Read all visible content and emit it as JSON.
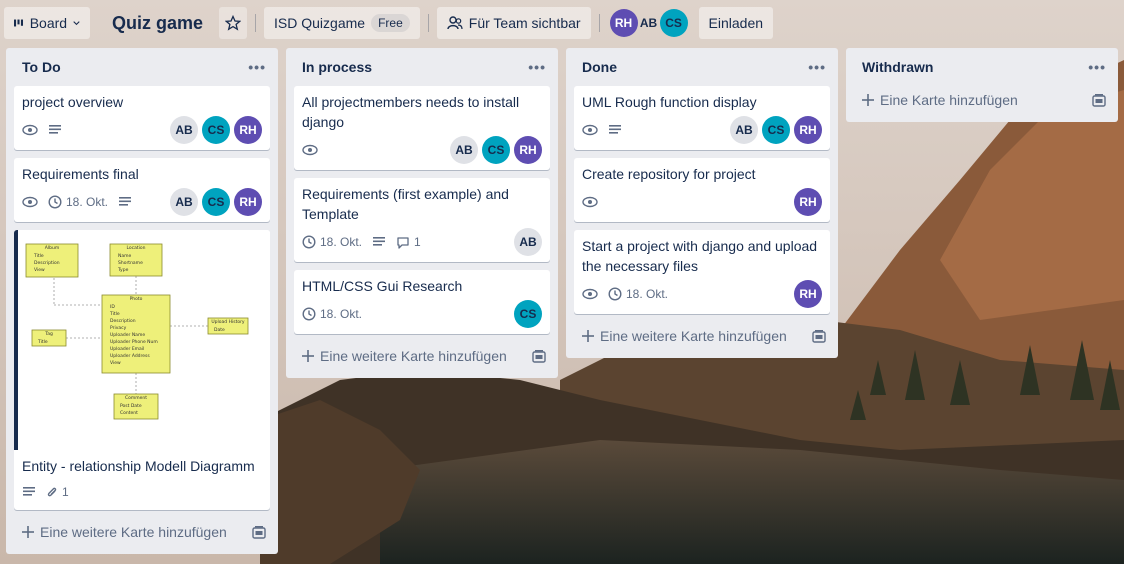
{
  "header": {
    "board_button": "Board",
    "board_title": "Quiz game",
    "workspace": "ISD Quizgame",
    "plan_badge": "Free",
    "visibility": "Für Team sichtbar",
    "invite": "Einladen",
    "members": [
      "RH",
      "AB",
      "CS"
    ]
  },
  "lists": [
    {
      "title": "To Do",
      "cards": [
        {
          "title": "project overview",
          "members": [
            "AB",
            "CS",
            "RH"
          ]
        },
        {
          "title": "Requirements final",
          "date": "18. Okt.",
          "members": [
            "AB",
            "CS",
            "RH"
          ]
        },
        {
          "title": "Entity - relationship Modell Diagramm",
          "attachments": "1",
          "diagram": {
            "entities": [
              {
                "name": "Album",
                "fields": [
                  "Title",
                  "Description",
                  "View"
                ]
              },
              {
                "name": "Location",
                "fields": [
                  "Name",
                  "Shortname",
                  "Type"
                ]
              },
              {
                "name": "Photo",
                "fields": [
                  "ID",
                  "Title",
                  "Description",
                  "Privacy",
                  "Uploader Name",
                  "Uploader Phone Num",
                  "Uploader Email",
                  "Uploader Address",
                  "View"
                ]
              },
              {
                "name": "Tag",
                "fields": [
                  "Title"
                ]
              },
              {
                "name": "Upload History",
                "fields": [
                  "Date"
                ]
              },
              {
                "name": "Comment",
                "fields": [
                  "Post Date",
                  "Content"
                ]
              }
            ]
          }
        }
      ],
      "add_label": "Eine weitere Karte hinzufügen"
    },
    {
      "title": "In process",
      "cards": [
        {
          "title": "All projectmembers needs to install django",
          "members": [
            "AB",
            "CS",
            "RH"
          ]
        },
        {
          "title": "Requirements (first example) and Template",
          "date": "18. Okt.",
          "comments": "1",
          "members": [
            "AB"
          ]
        },
        {
          "title": "HTML/CSS Gui Research",
          "date": "18. Okt.",
          "members": [
            "CS"
          ]
        }
      ],
      "add_label": "Eine weitere Karte hinzufügen"
    },
    {
      "title": "Done",
      "cards": [
        {
          "title": "UML Rough function display",
          "members": [
            "AB",
            "CS",
            "RH"
          ]
        },
        {
          "title": "Create repository for project",
          "members": [
            "RH"
          ]
        },
        {
          "title": "Start a project with django and upload the necessary files",
          "date": "18. Okt.",
          "members": [
            "RH"
          ]
        }
      ],
      "add_label": "Eine weitere Karte hinzufügen"
    },
    {
      "title": "Withdrawn",
      "cards": [],
      "add_label": "Eine Karte hinzufügen"
    }
  ],
  "colors": {
    "ab": "#dfe1e6",
    "cs": "#00a3bf",
    "rh": "#5e4db2",
    "list_bg": "#ebecf0"
  }
}
